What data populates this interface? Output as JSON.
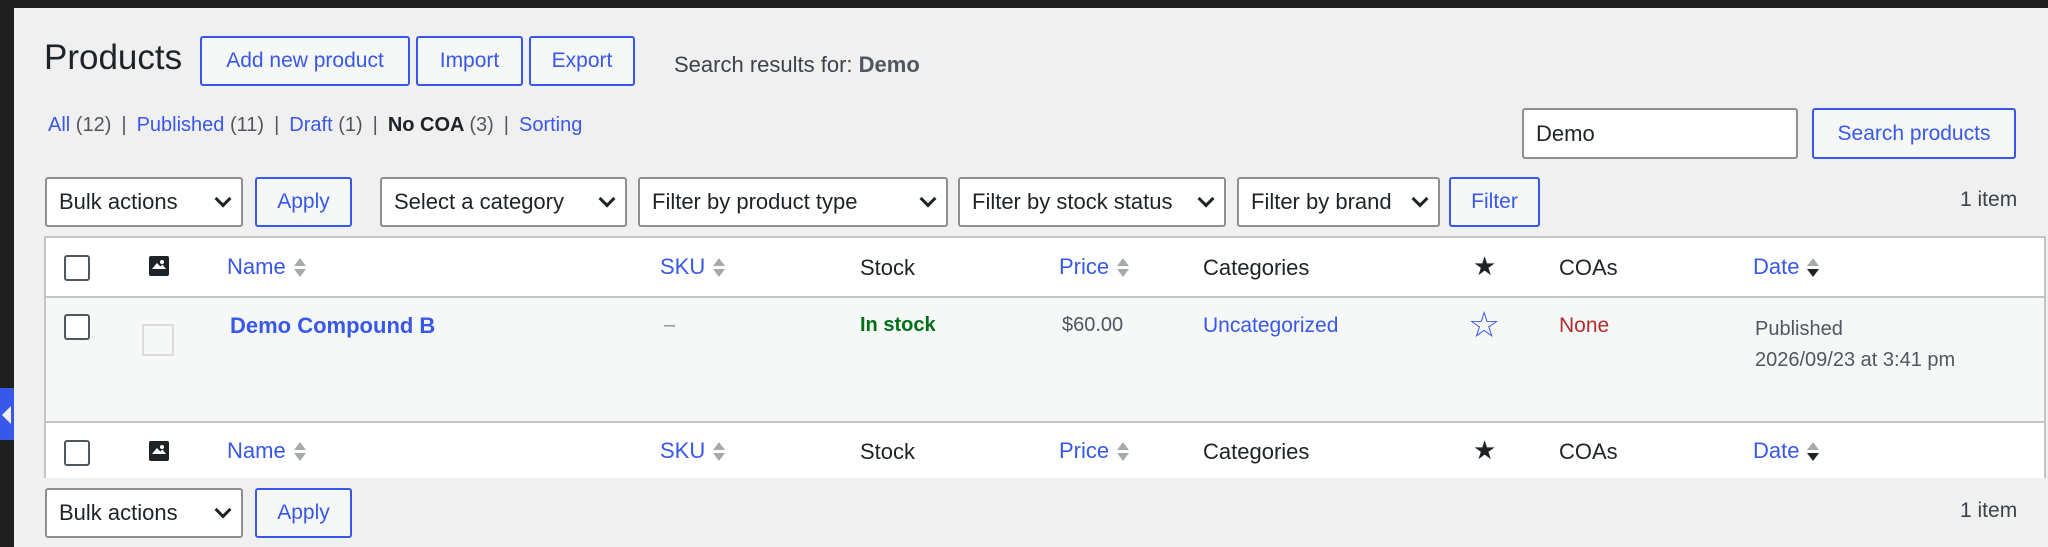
{
  "header": {
    "title": "Products",
    "add_new": "Add new product",
    "import": "Import",
    "export": "Export",
    "search_results_prefix": "Search results for: ",
    "search_term": "Demo"
  },
  "views": [
    {
      "label": "All",
      "count": "(12)"
    },
    {
      "label": "Published",
      "count": "(11)"
    },
    {
      "label": "Draft",
      "count": "(1)"
    },
    {
      "label": "No COA",
      "count": "(3)"
    },
    {
      "label": "Sorting",
      "count": ""
    }
  ],
  "search": {
    "value": "Demo",
    "button": "Search products"
  },
  "filters": {
    "bulk_actions": "Bulk actions",
    "apply": "Apply",
    "category": "Select a category",
    "product_type": "Filter by product type",
    "stock_status": "Filter by stock status",
    "brand": "Filter by brand",
    "filter_button": "Filter",
    "items_count": "1 item"
  },
  "columns": {
    "name": "Name",
    "sku": "SKU",
    "stock": "Stock",
    "price": "Price",
    "categories": "Categories",
    "coas": "COAs",
    "date": "Date"
  },
  "rows": [
    {
      "name": "Demo Compound B",
      "sku": "–",
      "stock": "In stock",
      "price": "$60.00",
      "categories": "Uncategorized",
      "coas": "None",
      "date_status": "Published",
      "date_value": "2026/09/23 at 3:41 pm"
    }
  ],
  "bottom": {
    "bulk_actions": "Bulk actions",
    "apply": "Apply",
    "items_count": "1 item"
  },
  "colors": {
    "accent": "#3858e9",
    "in_stock": "#007017",
    "none": "#b32d2e"
  }
}
